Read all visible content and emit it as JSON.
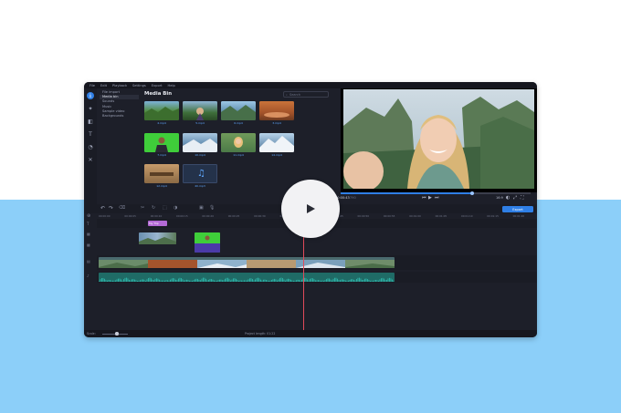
{
  "menu": [
    "File",
    "Edit",
    "Playback",
    "Settings",
    "Export",
    "Help"
  ],
  "nav_items": [
    "File import",
    "Media bin",
    "Sounds",
    "Music",
    "Sample video",
    "Backgrounds"
  ],
  "nav_active": 1,
  "media_bin": {
    "title": "Media Bin",
    "search_placeholder": "Search",
    "items": [
      {
        "label": "4.mp4"
      },
      {
        "label": "5.mp4"
      },
      {
        "label": "6.mp4"
      },
      {
        "label": "3.mp4"
      },
      {
        "label": "7.mp4"
      },
      {
        "label": "10.mp4"
      },
      {
        "label": "11.mp4"
      },
      {
        "label": "14.mp4"
      },
      {
        "label": "12.mp4"
      },
      {
        "label": "40.mp3"
      }
    ]
  },
  "player": {
    "timecode": "00:00:43",
    "timecode_suffix": "790",
    "aspect": "16:9",
    "progress": 0.69
  },
  "timeline": {
    "export_label": "Export",
    "title_clip_label": "My Trip",
    "ruler_ticks": [
      "00:00:00",
      "00:00:05",
      "00:00:10",
      "00:00:15",
      "00:00:20",
      "00:00:25",
      "00:00:30",
      "00:00:35",
      "00:00:40",
      "00:00:45",
      "00:00:50",
      "00:00:55",
      "00:01:00",
      "00:01:05",
      "00:01:10",
      "00:01:15",
      "00:01:20"
    ]
  },
  "status": {
    "scale_label": "Scale:",
    "project_length": "Project length: 01:22"
  },
  "colors": {
    "accent": "#2f7fe6",
    "page_blue": "#8ccff9",
    "audio_wave": "#2fb3a8",
    "playhead": "#e04a5a"
  }
}
